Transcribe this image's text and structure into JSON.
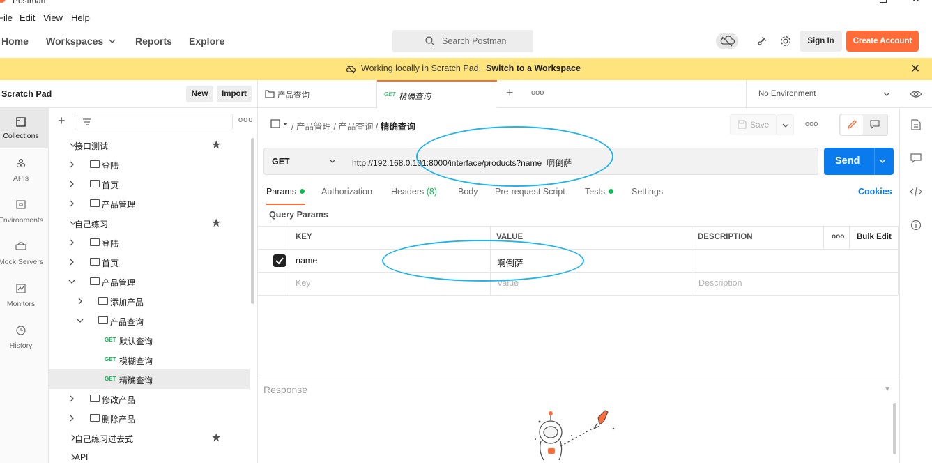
{
  "app": {
    "title": "Postman"
  },
  "menu": [
    "File",
    "Edit",
    "View",
    "Help"
  ],
  "nav": {
    "home": "Home",
    "workspaces": "Workspaces",
    "reports": "Reports",
    "explore": "Explore"
  },
  "search": {
    "placeholder": "Search Postman"
  },
  "header": {
    "sign_in": "Sign In",
    "create_account": "Create Account"
  },
  "banner": {
    "text": "Working locally in Scratch Pad.",
    "link": "Switch to a Workspace"
  },
  "sidebar": {
    "title": "Scratch Pad",
    "new_label": "New",
    "import_label": "Import",
    "more": "ooo",
    "rail": [
      "Collections",
      "APIs",
      "Environments",
      "Mock Servers",
      "Monitors",
      "History"
    ],
    "tree": [
      {
        "label": "接口测试",
        "type": "collection",
        "expanded": true,
        "star": true
      },
      {
        "label": "登陆",
        "type": "folder",
        "expanded": false
      },
      {
        "label": "首页",
        "type": "folder",
        "expanded": false
      },
      {
        "label": "产品管理",
        "type": "folder",
        "expanded": false
      },
      {
        "label": "自己练习",
        "type": "collection",
        "expanded": true,
        "star": true
      },
      {
        "label": "登陆",
        "type": "folder",
        "expanded": false
      },
      {
        "label": "首页",
        "type": "folder",
        "expanded": false
      },
      {
        "label": "产品管理",
        "type": "folder",
        "expanded": true
      },
      {
        "label": "添加产品",
        "type": "subfolder",
        "expanded": false
      },
      {
        "label": "产品查询",
        "type": "subfolder",
        "expanded": true
      },
      {
        "label": "默认查询",
        "type": "request",
        "method": "GET"
      },
      {
        "label": "模糊查询",
        "type": "request",
        "method": "GET"
      },
      {
        "label": "精确查询",
        "type": "request",
        "method": "GET",
        "selected": true
      },
      {
        "label": "修改产品",
        "type": "folder",
        "expanded": false
      },
      {
        "label": "删除产品",
        "type": "folder",
        "expanded": false
      },
      {
        "label": "自己练习过去式",
        "type": "collection",
        "expanded": false,
        "star": true
      },
      {
        "label": "API",
        "type": "collection",
        "expanded": false
      }
    ]
  },
  "tabs": [
    {
      "label": "产品查询",
      "type": "folder"
    },
    {
      "label": "精确查询",
      "method": "GET",
      "active": true
    }
  ],
  "tabs_more": "ooo",
  "environment": "No Environment",
  "request": {
    "breadcrumb": [
      "产品管理",
      "产品查询"
    ],
    "breadcrumb_current": "精确查询",
    "save_label": "Save",
    "more": "ooo",
    "method": "GET",
    "url": "http://192.168.0.101:8000/interface/products?name=啊倒萨",
    "send_label": "Send"
  },
  "request_tabs": {
    "params": "Params",
    "authorization": "Authorization",
    "headers": "Headers",
    "headers_count": "(8)",
    "body": "Body",
    "pre_request": "Pre-request Script",
    "tests": "Tests",
    "settings": "Settings",
    "cookies": "Cookies"
  },
  "query_params": {
    "title": "Query Params",
    "headers": {
      "key": "KEY",
      "value": "VALUE",
      "description": "DESCRIPTION",
      "more": "ooo",
      "bulk_edit": "Bulk Edit"
    },
    "rows": [
      {
        "checked": true,
        "key": "name",
        "value": "啊倒萨",
        "description": ""
      }
    ],
    "placeholder": {
      "key": "Key",
      "value": "Value",
      "description": "Description"
    }
  },
  "response": {
    "label": "Response"
  },
  "colors": {
    "accent": "#ff6c37",
    "send": "#097bed",
    "banner": "#ffe47e",
    "get": "#0cbb52",
    "annotation": "#1fb5ea"
  }
}
